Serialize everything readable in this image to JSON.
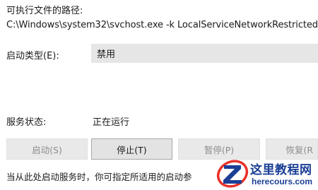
{
  "path": {
    "label": "可执行文件的路径:",
    "value": "C:\\Windows\\system32\\svchost.exe -k LocalServiceNetworkRestricted -"
  },
  "startup_type": {
    "label": "启动类型(E):",
    "value": "禁用"
  },
  "service_status": {
    "label": "服务状态:",
    "value": "正在运行"
  },
  "buttons": {
    "start": {
      "label": "启动(S)",
      "enabled": false
    },
    "stop": {
      "label": "停止(T)",
      "enabled": true
    },
    "pause": {
      "label": "暂停(P)",
      "enabled": false
    },
    "resume": {
      "label": "恢复(R",
      "enabled": false
    }
  },
  "hint_text": "当从此处启动服务时，你可指定所适用的启动参",
  "watermark": {
    "title": "这里教程网",
    "url": "herecours.com",
    "logo_icon": "z-logo-icon",
    "brand_color": "#1b3f95",
    "accent_color": "#e8322a"
  }
}
